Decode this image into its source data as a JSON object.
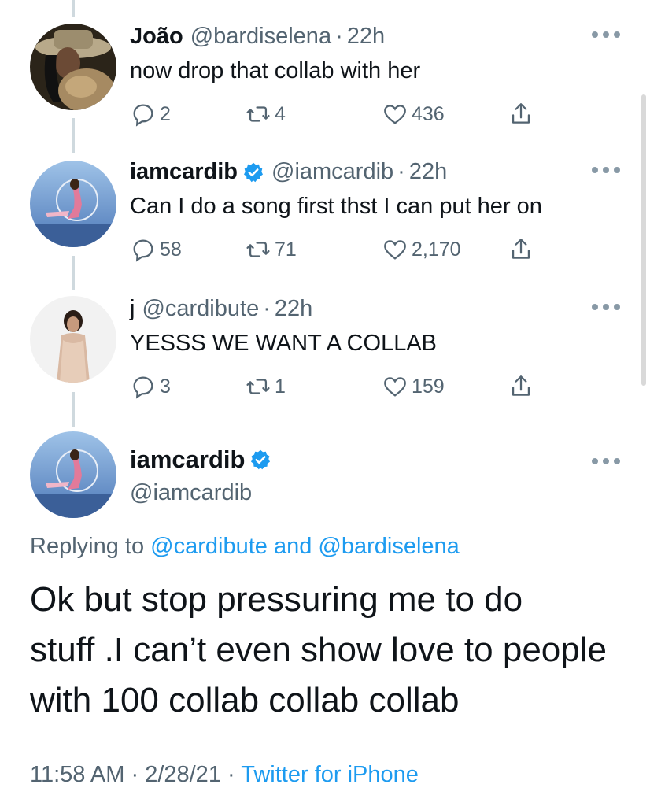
{
  "tweets": [
    {
      "name": "João",
      "handle": "@bardiselena",
      "time": "22h",
      "text": "now drop that collab with her",
      "replies": "2",
      "retweets": "4",
      "likes": "436",
      "verified": false,
      "avatar": "joao-avatar"
    },
    {
      "name": "iamcardib",
      "handle": "@iamcardib",
      "time": "22h",
      "text": "Can I do a song first thst I can put her on",
      "replies": "58",
      "retweets": "71",
      "likes": "2,170",
      "verified": true,
      "avatar": "cardib-avatar"
    },
    {
      "name": "j",
      "handle": "@cardibute",
      "time": "22h",
      "text": "YESSS WE WANT A COLLAB",
      "replies": "3",
      "retweets": "1",
      "likes": "159",
      "verified": false,
      "avatar": "j-avatar"
    }
  ],
  "main_tweet": {
    "name": "iamcardib",
    "handle": "@iamcardib",
    "replying_prefix": "Replying to",
    "mention_1": "@cardibute",
    "replying_and": "and",
    "mention_2": "@bardiselena",
    "text_lines": [
      "Ok but stop pressuring me to do",
      "stuff .I can’t even show love to people",
      "with 100 collab collab collab"
    ],
    "time": "11:58 AM",
    "date": "2/28/21",
    "source": "Twitter for iPhone"
  },
  "separator": "·",
  "colors": {
    "accent": "#1d9bf0",
    "secondary_text": "#536471",
    "thread_line": "#cfd9de"
  }
}
